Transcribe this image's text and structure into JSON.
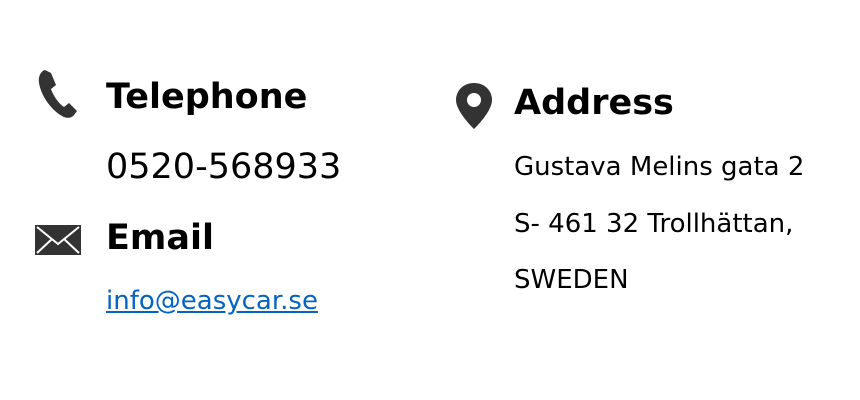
{
  "colors": {
    "text": "#000000",
    "icon": "#333333",
    "link": "#0563c1"
  },
  "telephone": {
    "icon": "phone-icon",
    "heading": "Telephone",
    "number": "0520-568933"
  },
  "email": {
    "icon": "envelope-icon",
    "heading": "Email",
    "address": "info@easycar.se"
  },
  "address": {
    "icon": "map-pin-icon",
    "heading": "Address",
    "lines": [
      "Gustava Melins gata 2",
      "S- 461 32 Trollhättan,",
      "SWEDEN"
    ]
  }
}
